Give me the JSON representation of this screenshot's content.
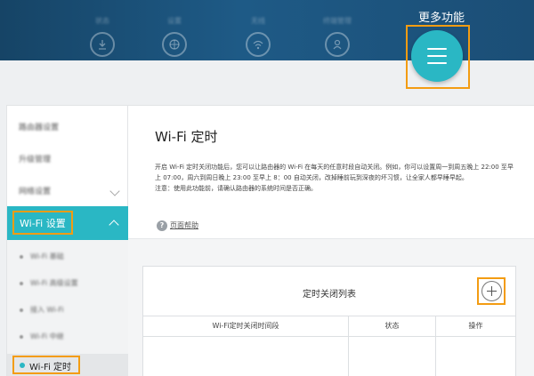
{
  "topnav": {
    "items": [
      {
        "label": "状态",
        "icon": "download-icon"
      },
      {
        "label": "设置",
        "icon": "globe-icon"
      },
      {
        "label": "无线",
        "icon": "wifi-icon"
      },
      {
        "label": "终端管理",
        "icon": "user-icon"
      }
    ],
    "more_label": "更多功能",
    "more_icon": "menu-icon"
  },
  "sidebar": {
    "items": [
      {
        "label": "路由器设置"
      },
      {
        "label": "升级管理"
      },
      {
        "label": "网络设置"
      }
    ],
    "active": {
      "label": "Wi-Fi 设置"
    },
    "subitems": [
      {
        "label": "Wi-Fi 基础"
      },
      {
        "label": "Wi-Fi 高级设置"
      },
      {
        "label": "接入 Wi-Fi"
      },
      {
        "label": "Wi-Fi 中继"
      }
    ],
    "current": {
      "label": "Wi-Fi 定时"
    }
  },
  "main": {
    "title": "Wi-Fi 定时",
    "desc1": "开启 Wi-Fi 定时关闭功能后，您可以让路由器的 Wi-Fi 在每天的任意时段自动关闭。例如，你可以设置周一到周五晚上 22:00 至早",
    "desc2": "上 07:00，周六到周日晚上 23:00 至早上 8：00 自动关闭，改掉睡前玩到深夜的坏习惯，让全家人都早睡早起。",
    "desc3": "注意：使用此功能前，请确认路由器的系统时间是否正确。",
    "help_label": "页面帮助",
    "schedule": {
      "title": "定时关闭列表",
      "columns": [
        "Wi-Fi定时关闭时间段",
        "状态",
        "操作"
      ],
      "rows": []
    }
  },
  "colors": {
    "nav_bg": "#1a4d77",
    "accent": "#2ab7c4",
    "highlight": "#f39c12"
  }
}
